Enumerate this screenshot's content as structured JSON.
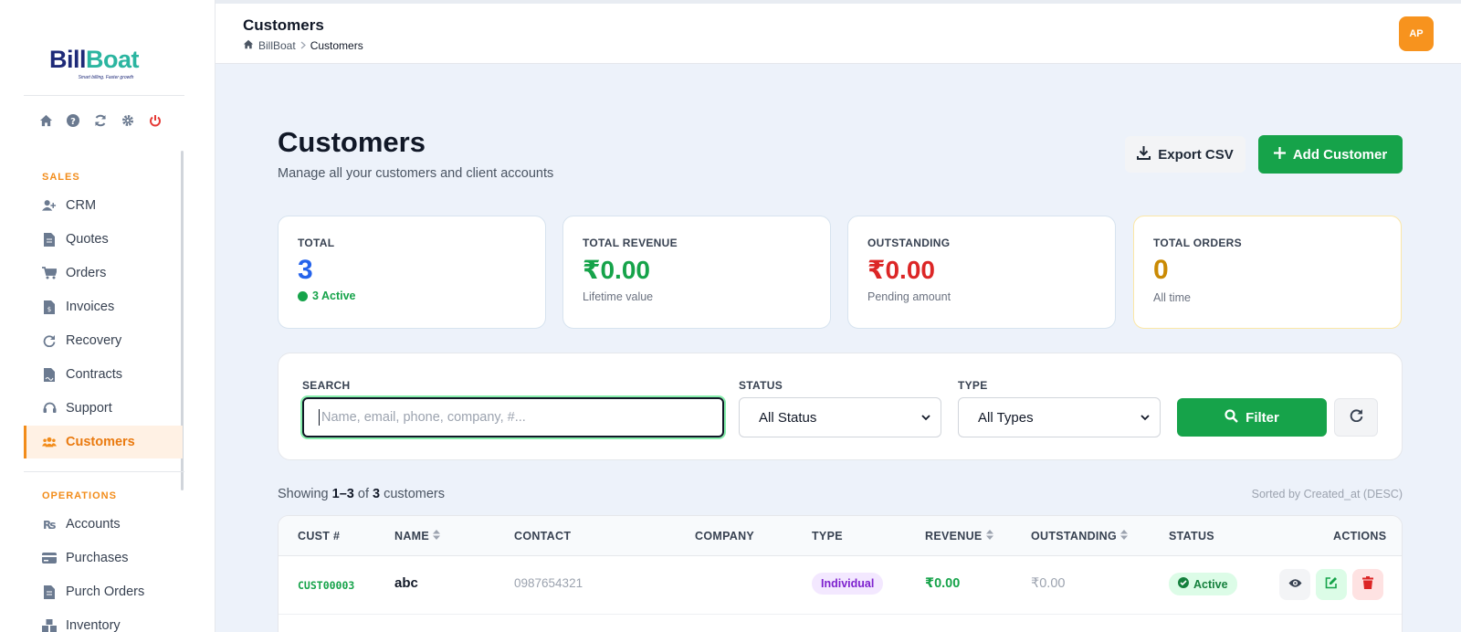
{
  "app": {
    "logo_part1": "Bill",
    "logo_part2": "Boat",
    "logo_tagline": "Smart billing. Faster growth"
  },
  "sidebar": {
    "sections": [
      {
        "title": "SALES"
      },
      {
        "title": "OPERATIONS"
      }
    ],
    "items": [
      {
        "label": "CRM",
        "icon": "user-plus-icon"
      },
      {
        "label": "Quotes",
        "icon": "file-icon"
      },
      {
        "label": "Orders",
        "icon": "cart-icon"
      },
      {
        "label": "Invoices",
        "icon": "invoice-icon"
      },
      {
        "label": "Recovery",
        "icon": "redo-icon"
      },
      {
        "label": "Contracts",
        "icon": "contract-icon"
      },
      {
        "label": "Support",
        "icon": "headset-icon"
      },
      {
        "label": "Customers",
        "icon": "users-icon",
        "active": true
      },
      {
        "label": "Accounts",
        "icon": "rupee-icon"
      },
      {
        "label": "Purchases",
        "icon": "card-icon"
      },
      {
        "label": "Purch Orders",
        "icon": "file-icon"
      },
      {
        "label": "Inventory",
        "icon": "boxes-icon"
      }
    ]
  },
  "header": {
    "title": "Customers",
    "breadcrumb": [
      "BillBoat",
      "Customers"
    ],
    "avatar_initials": "AP"
  },
  "page": {
    "title": "Customers",
    "subtitle": "Manage all your customers and client accounts",
    "export_label": "Export CSV",
    "add_label": "Add Customer"
  },
  "stats": [
    {
      "label": "TOTAL",
      "value": "3",
      "note": "3 Active",
      "color": "#2563eb"
    },
    {
      "label": "TOTAL REVENUE",
      "value": "₹0.00",
      "note": "Lifetime value",
      "color": "#16a34a"
    },
    {
      "label": "OUTSTANDING",
      "value": "₹0.00",
      "note": "Pending amount",
      "color": "#dc2626"
    },
    {
      "label": "TOTAL ORDERS",
      "value": "0",
      "note": "All time",
      "color": "#ca8a04"
    }
  ],
  "filters": {
    "search_label": "SEARCH",
    "search_placeholder": "Name, email, phone, company, #...",
    "status_label": "STATUS",
    "status_value": "All Status",
    "type_label": "TYPE",
    "type_value": "All Types",
    "filter_button": "Filter"
  },
  "results": {
    "showing_prefix": "Showing ",
    "range": "1–3",
    "of": " of ",
    "count": "3",
    "suffix": " customers",
    "sorted": "Sorted by Created_at (DESC)"
  },
  "table": {
    "headers": [
      "CUST #",
      "NAME",
      "CONTACT",
      "COMPANY",
      "TYPE",
      "REVENUE",
      "OUTSTANDING",
      "STATUS",
      "ACTIONS"
    ],
    "rows": [
      {
        "id": "CUST00003",
        "name": "abc",
        "contact": "0987654321",
        "company": "",
        "type": "Individual",
        "revenue": "₹0.00",
        "outstanding": "₹0.00",
        "status": "Active"
      }
    ]
  }
}
